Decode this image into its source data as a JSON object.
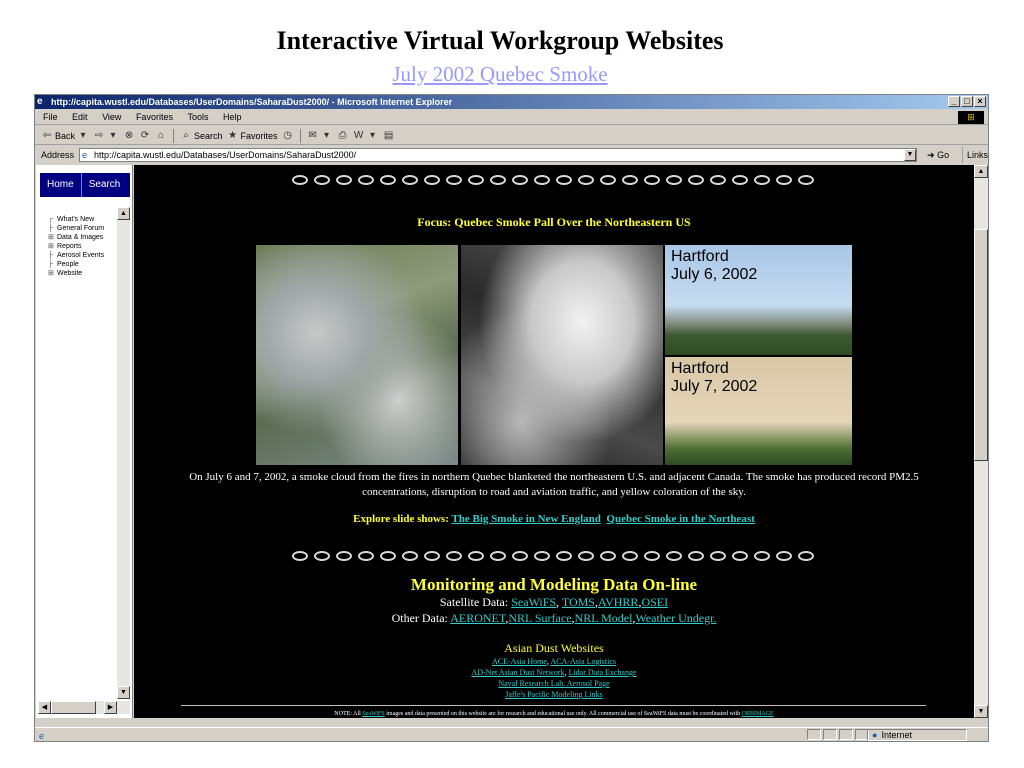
{
  "slide": {
    "title": "Interactive Virtual Workgroup Websites",
    "subtitle": "July 2002 Quebec Smoke"
  },
  "browser": {
    "title": "http://capita.wustl.edu/Databases/UserDomains/SaharaDust2000/ - Microsoft Internet Explorer",
    "menu": [
      "File",
      "Edit",
      "View",
      "Favorites",
      "Tools",
      "Help"
    ],
    "toolbar": {
      "back": "Back",
      "search": "Search",
      "favorites": "Favorites"
    },
    "address_label": "Address",
    "address_value": "http://capita.wustl.edu/Databases/UserDomains/SaharaDust2000/",
    "go": "Go",
    "links": "Links",
    "status_zone": "Internet"
  },
  "leftpane": {
    "tabs": [
      "Home",
      "Search"
    ],
    "tree": [
      {
        "prefix": "┌",
        "label": "What's New"
      },
      {
        "prefix": "├",
        "label": "General Forum"
      },
      {
        "prefix": "⊞",
        "label": "Data & Images"
      },
      {
        "prefix": "⊞",
        "label": "Reports"
      },
      {
        "prefix": "├",
        "label": "Aerosol Events"
      },
      {
        "prefix": "├",
        "label": "People"
      },
      {
        "prefix": "⊞",
        "label": "Website"
      }
    ]
  },
  "content": {
    "focus": "Focus: Quebec Smoke Pall Over the Northeastern US",
    "photos": {
      "hartford1": [
        "Hartford",
        "July 6, 2002"
      ],
      "hartford2": [
        "Hartford",
        "July 7, 2002"
      ]
    },
    "caption": "On July 6 and 7, 2002, a smoke cloud from the fires in northern Quebec blanketed the northeastern U.S. and adjacent Canada. The smoke has produced record PM2.5 concentrations, disruption to road and aviation traffic, and yellow coloration of the sky.",
    "explore_label": "Explore slide shows:",
    "explore_links": [
      "The Big Smoke in New England",
      "Quebec Smoke in the Northeast"
    ],
    "monitoring_title": "Monitoring and Modeling Data On-line",
    "satellite_label": "Satellite Data:",
    "satellite_links": [
      "SeaWiFS",
      "TOMS",
      "AVHRR",
      "OSEI"
    ],
    "other_label": "Other Data:",
    "other_links": [
      "AERONET",
      "NRL Surface",
      "NRL Model",
      "Weather Undegr."
    ],
    "asian_title": "Asian Dust Websites",
    "asian_lines": [
      [
        "ACE-Asia Home",
        "ACA-Asia Logistics"
      ],
      [
        "AD-Net Asian Dust Network",
        "Lidar Data Exchange"
      ],
      [
        "Naval Research Lab. Aerosol Page"
      ],
      [
        "Jaffe's Pacific Modeling Links"
      ]
    ],
    "note_prefix": "NOTE: All",
    "note_link1": "SeaWiFS",
    "note_text": "images and data presented on this website are for research and educational use only. All commercial use of SeaWiFS data must be coordinated with",
    "note_link2": "ORBIMAGE"
  }
}
